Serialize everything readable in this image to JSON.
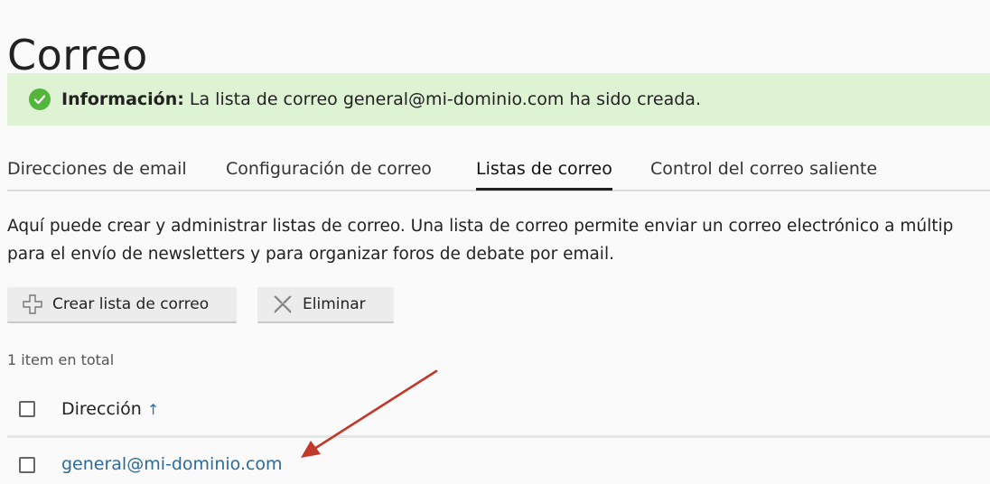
{
  "page": {
    "title": "Correo"
  },
  "alert": {
    "label": "Información:",
    "message": " La lista de correo general@mi-dominio.com ha sido creada."
  },
  "tabs": [
    {
      "label": "Direcciones de email"
    },
    {
      "label": "Configuración de correo"
    },
    {
      "label": "Listas de correo"
    },
    {
      "label": "Control del correo saliente"
    }
  ],
  "description": {
    "line1": "Aquí puede crear y administrar listas de correo. Una lista de correo permite enviar un correo electrónico a múltip",
    "line2": "para el envío de newsletters y para organizar foros de debate por email."
  },
  "toolbar": {
    "create_label": "Crear lista de correo",
    "delete_label": "Eliminar"
  },
  "list": {
    "total_text": "1 item en total",
    "column_header": "Dirección",
    "sort_indicator": "↑",
    "rows": [
      {
        "address": "general@mi-dominio.com"
      }
    ]
  },
  "icons": {
    "alert": "check-circle-icon",
    "create": "plus-icon",
    "delete": "x-icon",
    "sort": "sort-ascending-icon"
  },
  "colors": {
    "alert_background": "#ddf3d3",
    "success_green": "#54b53c",
    "link_blue": "#2e6a99",
    "annotation_red": "#c0392b"
  }
}
